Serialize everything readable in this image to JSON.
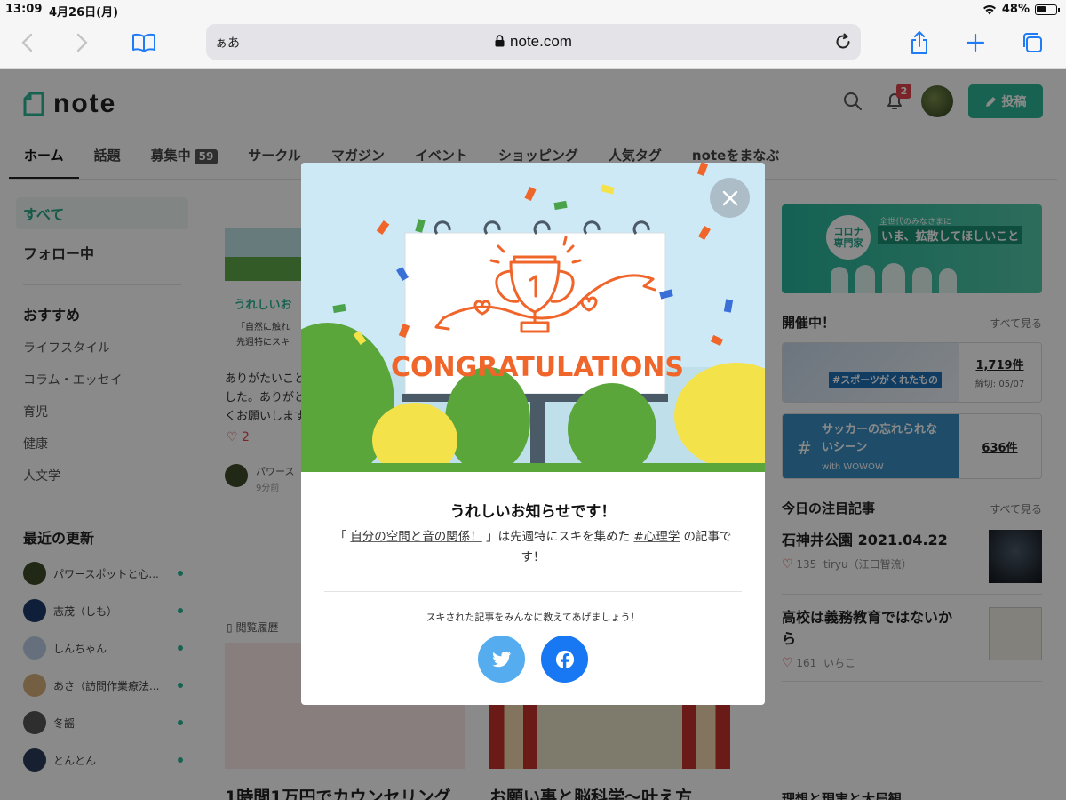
{
  "status": {
    "time": "13:09",
    "date": "4月26日(月)",
    "battery": "48%"
  },
  "safari": {
    "aa": "ぁあ",
    "host": "note.com"
  },
  "header": {
    "logo": "note",
    "notifications": "2",
    "post": "投稿"
  },
  "tabs": [
    {
      "label": "ホーム"
    },
    {
      "label": "話題"
    },
    {
      "label": "募集中",
      "count": "59"
    },
    {
      "label": "サークル"
    },
    {
      "label": "マガジン"
    },
    {
      "label": "イベント"
    },
    {
      "label": "ショッピング"
    },
    {
      "label": "人気タグ"
    },
    {
      "label": "noteをまなぶ"
    }
  ],
  "sidebar": {
    "nav": [
      "すべて",
      "フォロー中"
    ],
    "recommend_title": "おすすめ",
    "categories": [
      "ライフスタイル",
      "コラム・エッセイ",
      "育児",
      "健康",
      "人文学"
    ],
    "updates_title": "最近の更新",
    "updates": [
      "パワースポットと心...",
      "志茂（しも）",
      "しんちゃん",
      "あさ（訪問作業療法...",
      "冬謡",
      "とんとん"
    ]
  },
  "feed": {
    "card_title": "うれしいお",
    "card_sub": "「自然に触れ",
    "card_sub2": "先週特にスキ",
    "text": "ありがたいこと",
    "text2": "した。ありがと",
    "text3": "くお願いします",
    "likes": "2",
    "author": "パワース",
    "time": "9分前",
    "history": "閲覧履歴",
    "bottom1": "1時間1万円でカウンセリング",
    "bottom2": "お願い事と脳科学〜叶え方"
  },
  "right": {
    "banner_kicker": "全世代のみなさまに",
    "banner_main": "いま、拡散してほしいこと",
    "banner_badge": "コロナ専門家",
    "events_title": "開催中！",
    "see_all": "すべて見る",
    "event1": {
      "tag": "#スポーツがくれたもの",
      "count": "1,719件",
      "deadline": "締切: 05/07"
    },
    "event2": {
      "tag": "サッカーの忘れられないシーン",
      "sub": "with WOWOW",
      "count": "636件"
    },
    "today_title": "今日の注目記事",
    "articles": [
      {
        "title": "石神井公園 2021.04.22",
        "likes": "135",
        "author": "tiryu（江口智流）"
      },
      {
        "title": "高校は義務教育ではないから",
        "likes": "161",
        "author": "いちこ"
      }
    ],
    "bottom": "理想と現実と大局観..."
  },
  "modal": {
    "image_text": "CONGRATULATIONS",
    "title": "うれしいお知らせです！",
    "body_pre": "「",
    "article_link": "自分の空間と音の関係！",
    "body_mid": "」は先週特にスキを集めた",
    "tag_link": "#心理学",
    "body_post": "の記事です！",
    "share_prompt": "スキされた記事をみんなに教えてあげましょう！"
  },
  "colors": {
    "accent": "#2cb696",
    "twitter": "#55acee",
    "facebook": "#1877f2",
    "trophy": "#f0652a"
  }
}
